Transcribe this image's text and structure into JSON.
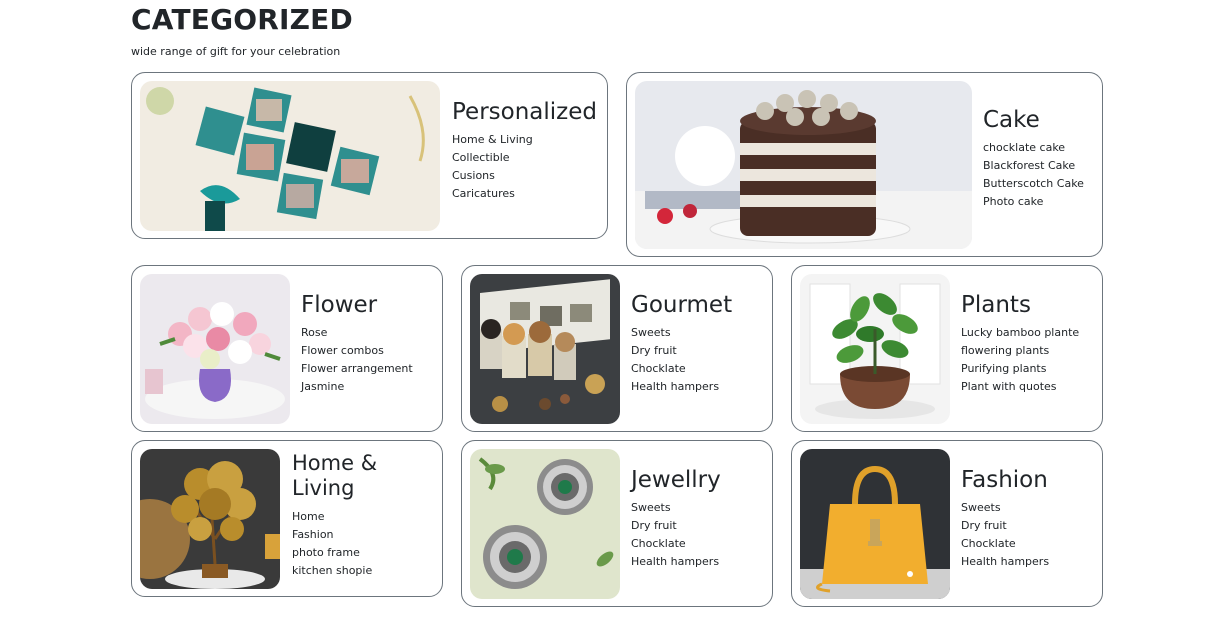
{
  "header": {
    "title": "CATEGORIZED",
    "subtitle": "wide range of gift for your celebration"
  },
  "colors": {
    "card_border": "#6c757d",
    "text": "#212529",
    "accent_teal": "#1f8a8a"
  },
  "categories": [
    {
      "title": "Personalized",
      "items": [
        "Home & Living",
        "Collectible",
        "Cusions",
        "Caricatures"
      ],
      "image_icon": "personalized-photo-frame-image"
    },
    {
      "title": "Cake",
      "items": [
        "chocklate cake",
        "Blackforest Cake",
        "Butterscotch Cake",
        "Photo cake"
      ],
      "image_icon": "layered-cake-image"
    },
    {
      "title": "Flower",
      "items": [
        "Rose",
        "Flower combos",
        "Flower arrangement",
        "Jasmine"
      ],
      "image_icon": "flower-vase-image"
    },
    {
      "title": "Gourmet",
      "items": [
        "Sweets",
        "Dry fruit",
        "Chocklate",
        "Health hampers"
      ],
      "image_icon": "gourmet-hamper-image"
    },
    {
      "title": "Plants",
      "items": [
        "Lucky bamboo plante",
        "flowering plants",
        "Purifying plants",
        "Plant with quotes"
      ],
      "image_icon": "potted-plant-image"
    },
    {
      "title": "Home & Living",
      "items": [
        "Home",
        "Fashion",
        "photo frame",
        "kitchen shopie"
      ],
      "image_icon": "golden-tree-image"
    },
    {
      "title": "Jewellry",
      "items": [
        "Sweets",
        "Dry fruit",
        "Chocklate",
        "Health hampers"
      ],
      "image_icon": "earrings-image"
    },
    {
      "title": "Fashion",
      "items": [
        "Sweets",
        "Dry fruit",
        "Chocklate",
        "Health hampers"
      ],
      "image_icon": "yellow-handbag-image"
    }
  ]
}
